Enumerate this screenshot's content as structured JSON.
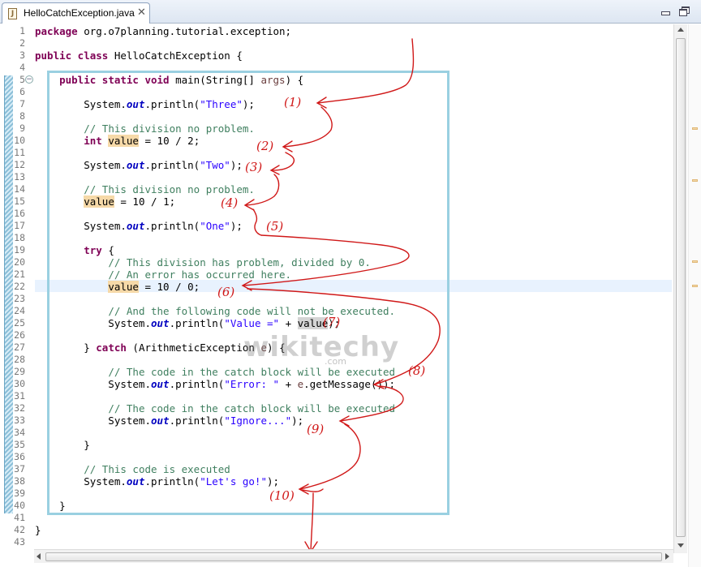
{
  "editor": {
    "tab": {
      "label": "HelloCatchException.java",
      "icon": "java-file-icon",
      "close": "✕"
    },
    "current_line": 22
  },
  "code_lines": [
    {
      "n": "1",
      "html": "<span class='kw'>package</span> org.o7planning.tutorial.exception;"
    },
    {
      "n": "2",
      "html": ""
    },
    {
      "n": "3",
      "html": "<span class='kw'>public class</span> HelloCatchException {"
    },
    {
      "n": "4",
      "html": ""
    },
    {
      "n": "5",
      "html": "    <span class='kw'>public static void</span> main(String[] <span class='var'>args</span>) {"
    },
    {
      "n": "6",
      "html": ""
    },
    {
      "n": "7",
      "html": "        System.<span class='it'>out</span>.println(<span class='str'>\"Three\"</span>);"
    },
    {
      "n": "8",
      "html": ""
    },
    {
      "n": "9",
      "html": "        <span class='cm'>// This division no problem.</span>"
    },
    {
      "n": "10",
      "html": "        <span class='kw'>int</span> <span class='occ'>value</span> = 10 / 2;"
    },
    {
      "n": "11",
      "html": ""
    },
    {
      "n": "12",
      "html": "        System.<span class='it'>out</span>.println(<span class='str'>\"Two\"</span>);"
    },
    {
      "n": "13",
      "html": ""
    },
    {
      "n": "14",
      "html": "        <span class='cm'>// This division no problem.</span>"
    },
    {
      "n": "15",
      "html": "        <span class='occ'>value</span> = 10 / 1;"
    },
    {
      "n": "16",
      "html": ""
    },
    {
      "n": "17",
      "html": "        System.<span class='it'>out</span>.println(<span class='str'>\"One\"</span>);"
    },
    {
      "n": "18",
      "html": ""
    },
    {
      "n": "19",
      "html": "        <span class='kw'>try</span> {"
    },
    {
      "n": "20",
      "html": "            <span class='cm'>// This division has problem, divided by 0.</span>"
    },
    {
      "n": "21",
      "html": "            <span class='cm'>// An error has occurred here.</span>"
    },
    {
      "n": "22",
      "html": "            <span class='occ'>value</span> = 10 / 0;"
    },
    {
      "n": "23",
      "html": ""
    },
    {
      "n": "24",
      "html": "            <span class='cm'>// And the following code will not be executed.</span>"
    },
    {
      "n": "25",
      "html": "            System.<span class='it'>out</span>.println(<span class='str'>\"Value =\"</span> + <span class='occ2'>value</span>);"
    },
    {
      "n": "26",
      "html": ""
    },
    {
      "n": "27",
      "html": "        } <span class='kw'>catch</span> (ArithmeticException <span class='var'>e</span>) {"
    },
    {
      "n": "28",
      "html": ""
    },
    {
      "n": "29",
      "html": "            <span class='cm'>// The code in the catch block will be executed</span>"
    },
    {
      "n": "30",
      "html": "            System.<span class='it'>out</span>.println(<span class='str'>\"Error: \"</span> + <span class='var'>e</span>.getMessage());"
    },
    {
      "n": "31",
      "html": ""
    },
    {
      "n": "32",
      "html": "            <span class='cm'>// The code in the catch block will be executed</span>"
    },
    {
      "n": "33",
      "html": "            System.<span class='it'>out</span>.println(<span class='str'>\"Ignore...\"</span>);"
    },
    {
      "n": "34",
      "html": ""
    },
    {
      "n": "35",
      "html": "        }"
    },
    {
      "n": "36",
      "html": ""
    },
    {
      "n": "37",
      "html": "        <span class='cm'>// This code is executed</span>"
    },
    {
      "n": "38",
      "html": "        System.<span class='it'>out</span>.println(<span class='str'>\"Let's go!\"</span>);"
    },
    {
      "n": "39",
      "html": ""
    },
    {
      "n": "40",
      "html": "    }"
    },
    {
      "n": "41",
      "html": ""
    },
    {
      "n": "42",
      "html": "}"
    },
    {
      "n": "43",
      "html": ""
    }
  ],
  "annotations": [
    "(1)",
    "(2)",
    "(3)",
    "(4)",
    "(5)",
    "(6)",
    "(7)",
    "(8)",
    "(9)",
    "(10)"
  ],
  "watermark": {
    "text": "wikitechy",
    "sub": ".com"
  },
  "colors": {
    "annotation": "#d01818",
    "keyword": "#7f0055",
    "string": "#2a00ff",
    "comment": "#3f7f5f",
    "box": "#9ad0e1"
  }
}
